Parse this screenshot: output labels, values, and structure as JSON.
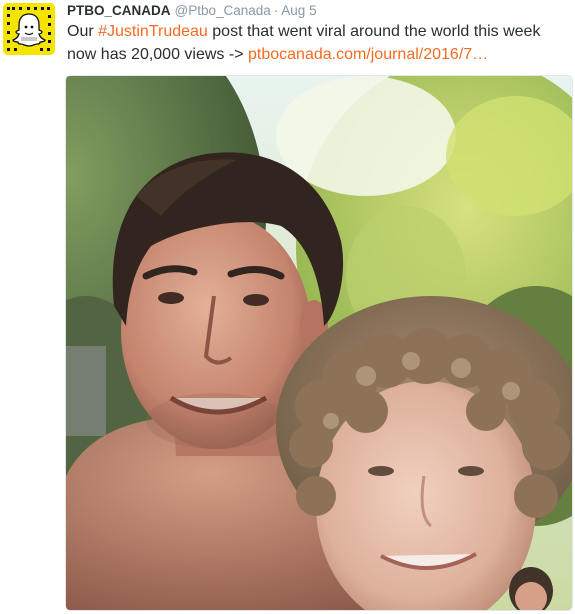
{
  "tweet": {
    "author_name": "PTBO_CANADA",
    "handle": "@Ptbo_Canada",
    "separator": "·",
    "time": "Aug 5",
    "line1_before": "Our ",
    "hashtag": "#JustinTrudeau",
    "line1_after": " post that went viral around the world this week",
    "line2_before": "now has 20,000 views -> ",
    "link": "ptbocanada.com/journal/2016/7…"
  },
  "colors": {
    "accent": "#f36b22",
    "avatar_background": "#f5e400",
    "muted_text": "#8899a6",
    "primary_text": "#292f33"
  },
  "icons": {
    "avatar": "snapcode-ghost-icon"
  },
  "photo": {
    "description_name": "selfie-photo"
  }
}
